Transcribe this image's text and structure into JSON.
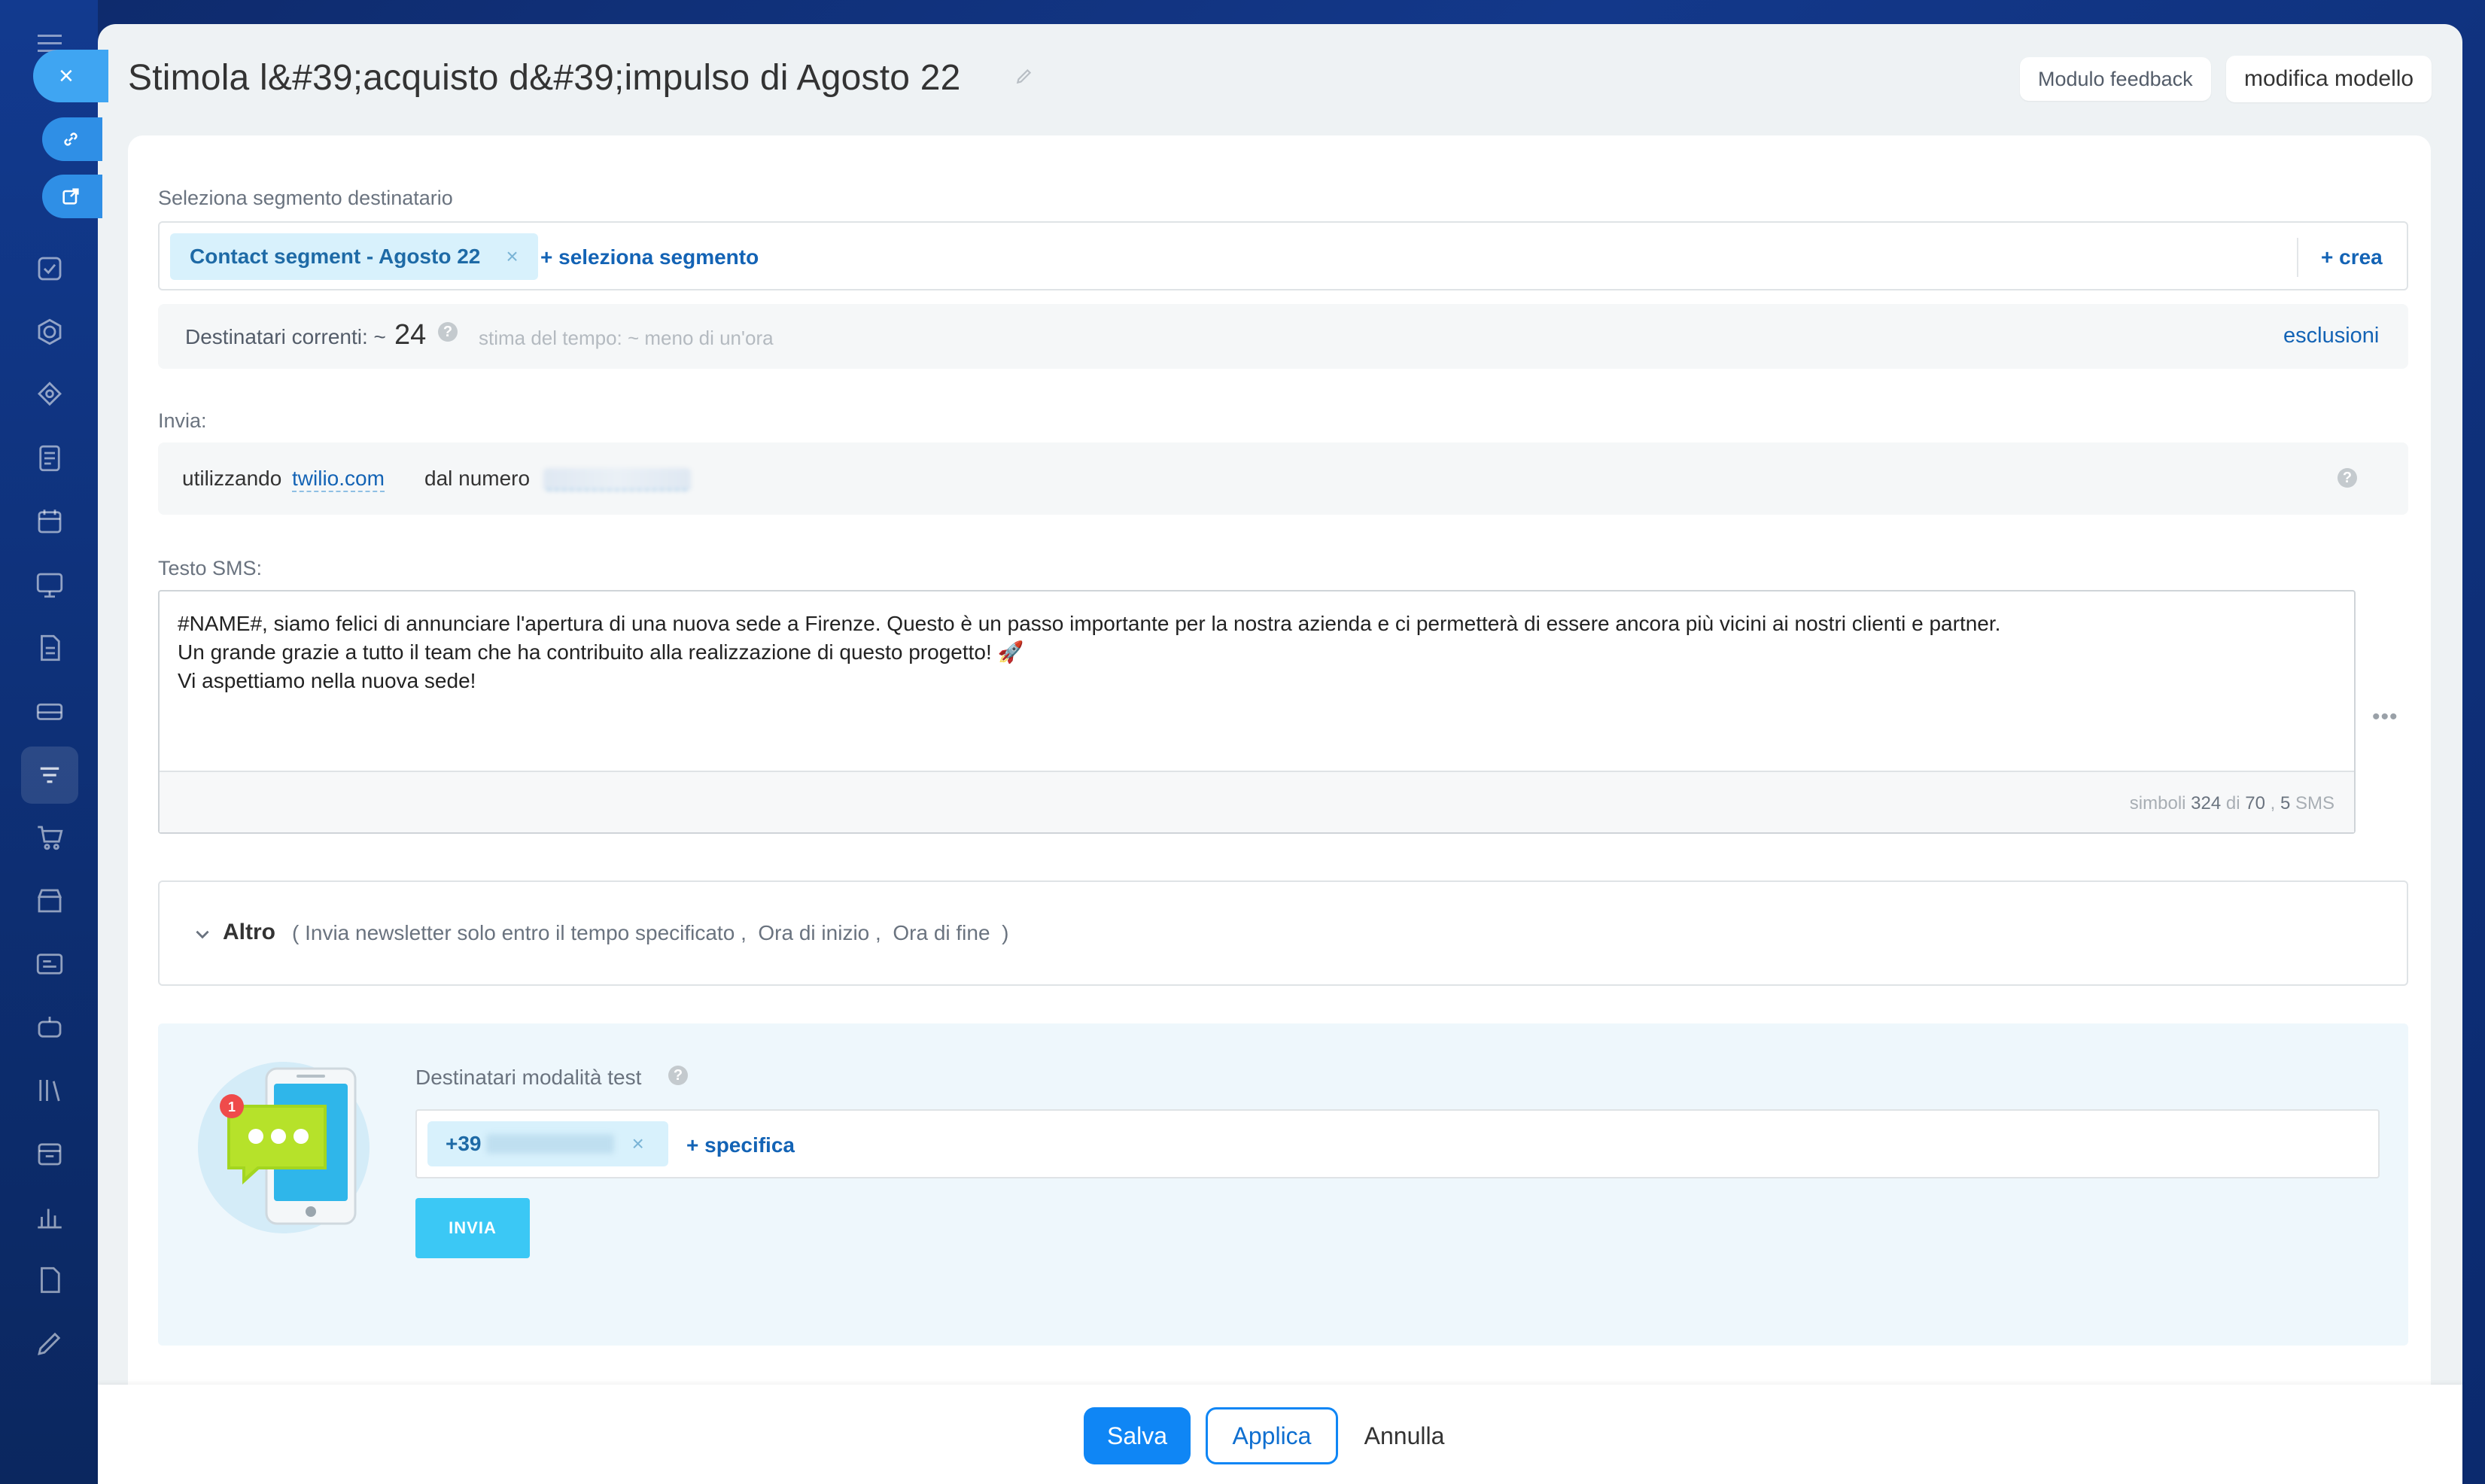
{
  "page": {
    "title": "Stimola l&#39;acquisto d&#39;impulso di Agosto 22",
    "feedback_btn": "Modulo feedback",
    "edit_template_btn": "modifica modello"
  },
  "segment": {
    "label": "Seleziona segmento destinatario",
    "tag": "Contact segment - Agosto 22",
    "tag_remove": "×",
    "select_link": "+ seleziona segmento",
    "create_link": "+ crea"
  },
  "recipients": {
    "label": "Destinatari correnti: ~",
    "count": "24",
    "help": "?",
    "estimate": "stima del tempo: ~ meno di un'ora",
    "exclusions_link": "esclusioni"
  },
  "send": {
    "label": "Invia:",
    "using": "utilizzando",
    "provider": "twilio.com",
    "from_number": "dal numero",
    "help": "?"
  },
  "sms": {
    "label": "Testo SMS:",
    "text": "#NAME#, siamo felici di annunciare l'apertura di una nuova sede a Firenze. Questo è un passo importante per la nostra azienda e ci permetterà di essere ancora più vicini ai nostri clienti e partner.\nUn grande grazie a tutto il team che ha contribuito alla realizzazione di questo progetto! 🚀\nVi aspettiamo nella nuova sede!",
    "count_prefix": "simboli",
    "count_value": "324",
    "count_of": "di",
    "count_max": "70",
    "count_sep": ",",
    "sms_count": "5",
    "sms_unit": "SMS",
    "more": "•••"
  },
  "other": {
    "title": "Altro",
    "details_open": "(",
    "detail1": "Invia newsletter solo entro il tempo specificato",
    "comma1": ",",
    "detail2": "Ora di inizio",
    "comma2": ",",
    "detail3": "Ora di fine",
    "details_close": ")"
  },
  "test": {
    "label": "Destinatari modalità test",
    "help": "?",
    "badge": "1",
    "phone_prefix": "+39",
    "remove": "×",
    "specify_link": "+ specifica",
    "send_btn": "INVIA"
  },
  "footer": {
    "save": "Salva",
    "apply": "Applica",
    "cancel": "Annulla"
  },
  "colors": {
    "accent": "#0f86f5",
    "link": "#1363b5",
    "send_button": "#3bc8f5",
    "tag_bg": "#d8f1fc"
  }
}
